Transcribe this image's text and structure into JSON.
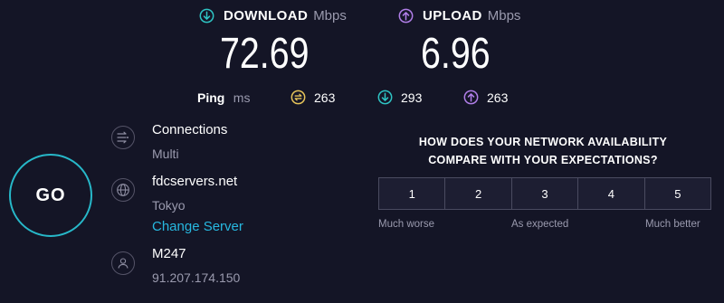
{
  "download": {
    "label": "DOWNLOAD",
    "unit": "Mbps",
    "value": "72.69",
    "icon": "arrow-down-circle-icon",
    "color": "#2ec4c4"
  },
  "upload": {
    "label": "UPLOAD",
    "unit": "Mbps",
    "value": "6.96",
    "icon": "arrow-up-circle-icon",
    "color": "#b07ee8"
  },
  "ping": {
    "label": "Ping",
    "unit": "ms",
    "idle": {
      "value": "263",
      "icon": "ping-idle-icon",
      "color": "#e6c45a"
    },
    "download": {
      "value": "293",
      "icon": "ping-download-icon",
      "color": "#2ec4c4"
    },
    "upload": {
      "value": "263",
      "icon": "ping-upload-icon",
      "color": "#b07ee8"
    }
  },
  "go_button": {
    "label": "GO",
    "color": "#27b8c9"
  },
  "connections": {
    "title": "Connections",
    "value": "Multi",
    "icon": "connections-icon"
  },
  "server": {
    "name": "fdcservers.net",
    "location": "Tokyo",
    "change_label": "Change Server",
    "icon": "globe-icon"
  },
  "isp": {
    "name": "M247",
    "ip": "91.207.174.150",
    "icon": "user-icon"
  },
  "survey": {
    "question_line1": "HOW DOES YOUR NETWORK AVAILABILITY",
    "question_line2": "COMPARE WITH YOUR EXPECTATIONS?",
    "options": [
      "1",
      "2",
      "3",
      "4",
      "5"
    ],
    "scale_low": "Much worse",
    "scale_mid": "As expected",
    "scale_high": "Much better"
  }
}
